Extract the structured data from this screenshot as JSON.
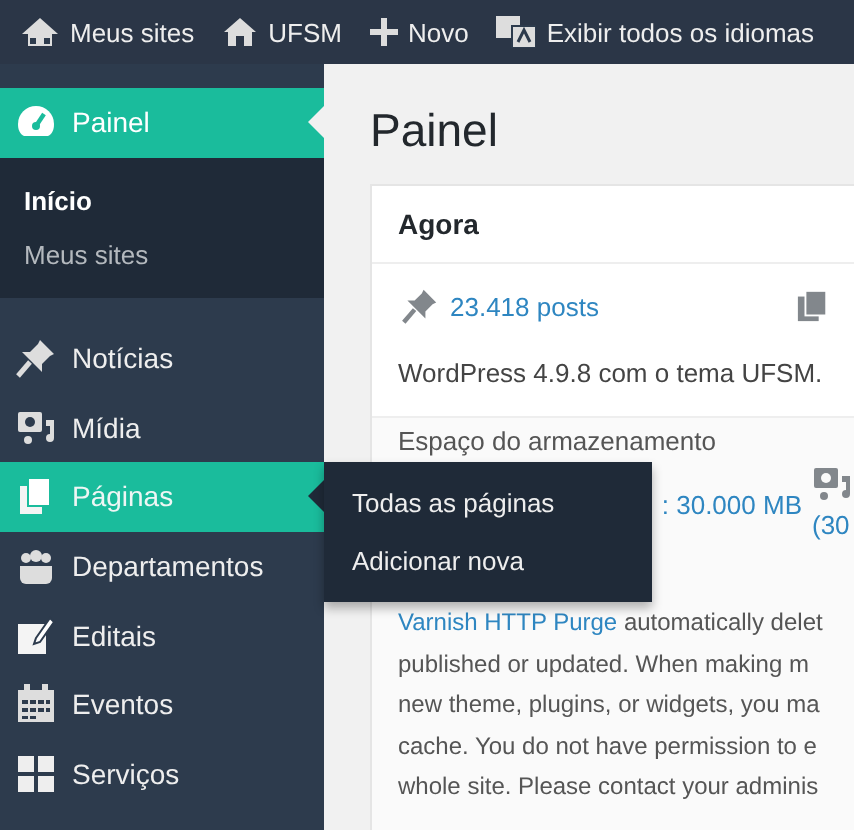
{
  "admin_bar": {
    "items": [
      {
        "kind": "sites",
        "label": "Meus sites"
      },
      {
        "kind": "home",
        "label": "UFSM"
      },
      {
        "kind": "new",
        "label": "Novo"
      },
      {
        "kind": "language",
        "label": "Exibir todos os idiomas"
      }
    ]
  },
  "sidebar": {
    "items": [
      {
        "kind": "dashboard",
        "label": "Painel",
        "selected": true,
        "hovered": false,
        "children": [
          {
            "label": "Início",
            "selected": true
          },
          {
            "label": "Meus sites",
            "selected": false
          }
        ]
      },
      {
        "kind": "pin",
        "label": "Notícias",
        "selected": false,
        "hovered": false
      },
      {
        "kind": "media",
        "label": "Mídia",
        "selected": false,
        "hovered": false
      },
      {
        "kind": "pages",
        "label": "Páginas",
        "selected": false,
        "hovered": true,
        "flyout": [
          {
            "label": "Todas as páginas"
          },
          {
            "label": "Adicionar nova"
          }
        ]
      },
      {
        "kind": "people",
        "label": "Departamentos",
        "selected": false,
        "hovered": false
      },
      {
        "kind": "edit",
        "label": "Editais",
        "selected": false,
        "hovered": false
      },
      {
        "kind": "calendar",
        "label": "Eventos",
        "selected": false,
        "hovered": false
      },
      {
        "kind": "grid",
        "label": "Serviços",
        "selected": false,
        "hovered": false
      }
    ]
  },
  "page": {
    "title": "Painel"
  },
  "card": {
    "title": "Agora",
    "posts": "23.418 posts",
    "version": "WordPress 4.9.8 com o tema UFSM.",
    "storage": {
      "label": "Espaço do armazenamento",
      "space": ": 30.000 MB",
      "percent": "(30"
    },
    "notice_link": "Varnish HTTP Purge",
    "notice_lines": [
      "automatically delet",
      "published or updated. When making m",
      "new theme, plugins, or widgets, you ma",
      "cache. You do not have permission to e",
      "whole site. Please contact your adminis"
    ]
  }
}
